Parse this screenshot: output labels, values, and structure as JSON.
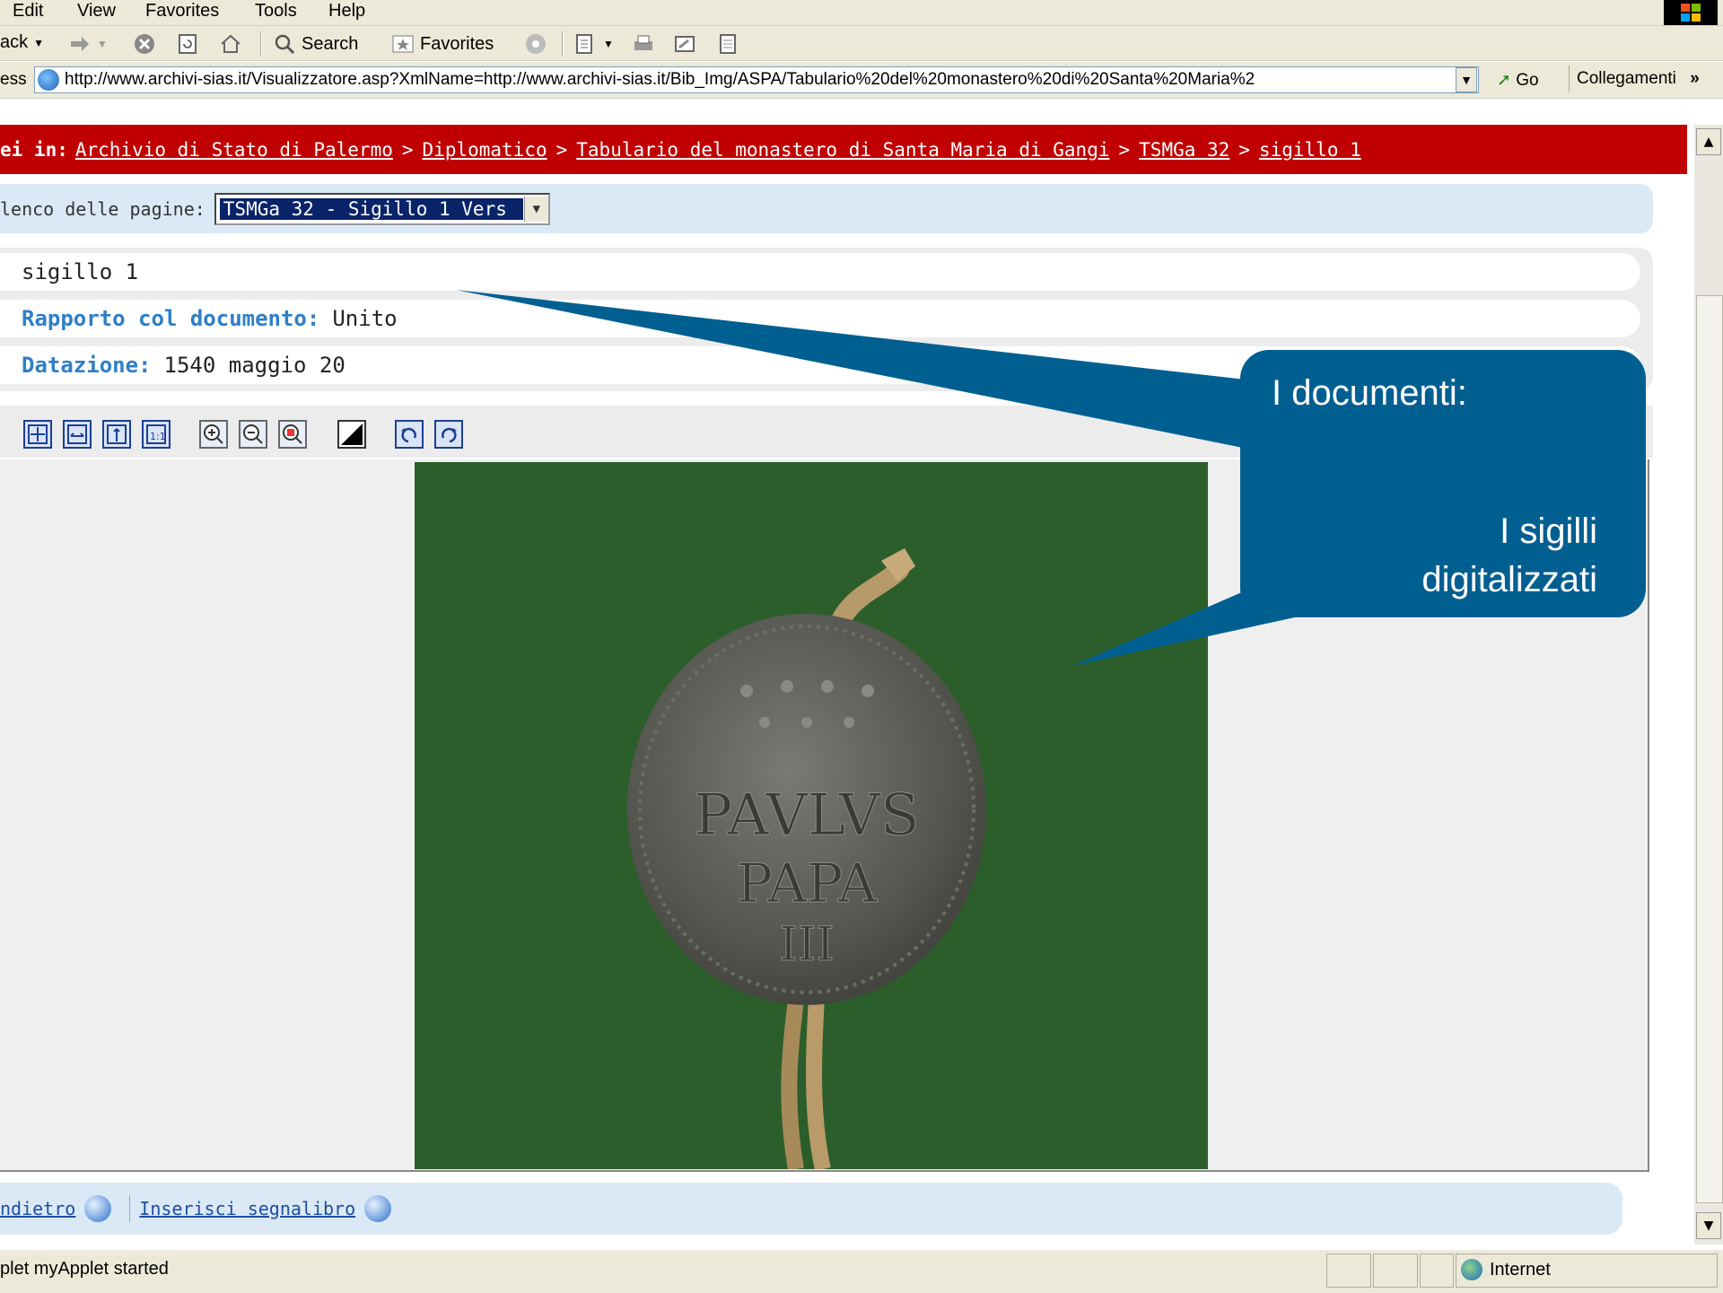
{
  "menu": [
    "Edit",
    "View",
    "Favorites",
    "Tools",
    "Help"
  ],
  "toolbar": {
    "back_label": "ack",
    "search_label": "Search",
    "favorites_label": "Favorites"
  },
  "address": {
    "label": "ess",
    "url": "http://www.archivi-sias.it/Visualizzatore.asp?XmlName=http://www.archivi-sias.it/Bib_Img/ASPA/Tabulario%20del%20monastero%20di%20Santa%20Maria%2",
    "go_label": "Go",
    "links_label": "Collegamenti",
    "links_more": "»"
  },
  "breadcrumb": {
    "prefix": "ei in:",
    "items": [
      "Archivio di Stato di Palermo",
      "Diplomatico",
      "Tabulario del monastero di Santa Maria di Gangi",
      "TSMGa 32",
      "sigillo 1"
    ],
    "separator": ">"
  },
  "pages": {
    "label": "lenco delle pagine:",
    "selected": "TSMGa 32 - Sigillo 1 Vers"
  },
  "record": {
    "title": "sigillo 1",
    "rapporto_label": "Rapporto col documento:",
    "rapporto_value": "Unito",
    "datazione_label": "Datazione:",
    "datazione_value": "1540 maggio 20"
  },
  "image_tools": [
    "fit-all-icon",
    "fit-width-icon",
    "fit-height-icon",
    "actual-size-icon",
    "zoom-in-icon",
    "zoom-out-icon",
    "zoom-area-icon",
    "contrast-icon",
    "rotate-left-icon",
    "rotate-right-icon"
  ],
  "seal": {
    "inscription": [
      "PAVLVS",
      "PAPA",
      "III"
    ]
  },
  "bottom": {
    "back_link": "ndietro",
    "bookmark_link": "Inserisci segnalibro"
  },
  "status": {
    "text": "plet myApplet started",
    "zone": "Internet"
  },
  "callout": {
    "line1": "I documenti:",
    "line2a": "I sigilli",
    "line2b": "digitalizzati"
  }
}
